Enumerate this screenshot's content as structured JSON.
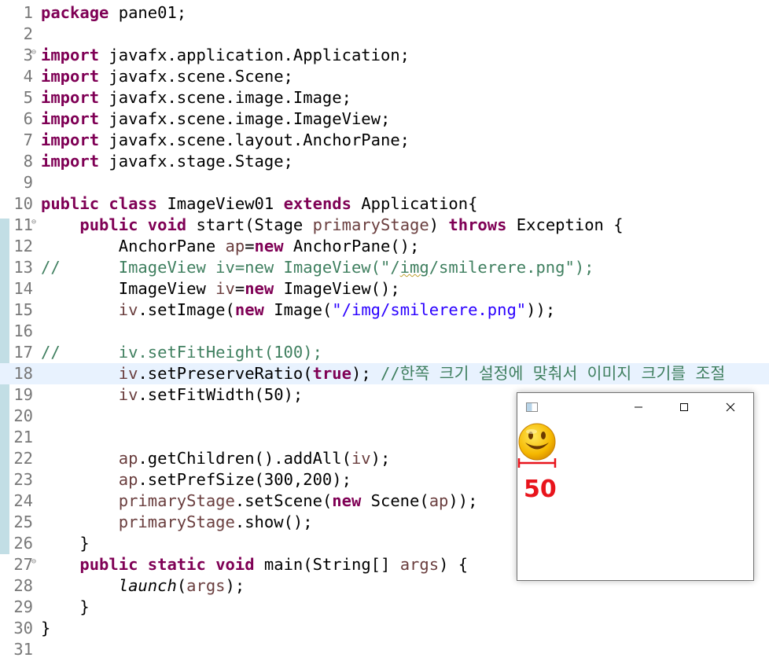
{
  "editor": {
    "lines": [
      {
        "num": "1",
        "fold": "",
        "current": false,
        "segments": [
          {
            "t": "package",
            "c": "kw"
          },
          {
            "t": " pane01;",
            "c": ""
          }
        ]
      },
      {
        "num": "2",
        "fold": "",
        "current": false,
        "segments": []
      },
      {
        "num": "3",
        "fold": "⊖",
        "current": false,
        "segments": [
          {
            "t": "import",
            "c": "kw"
          },
          {
            "t": " javafx.application.Application;",
            "c": ""
          }
        ]
      },
      {
        "num": "4",
        "fold": "",
        "current": false,
        "segments": [
          {
            "t": "import",
            "c": "kw"
          },
          {
            "t": " javafx.scene.Scene;",
            "c": ""
          }
        ]
      },
      {
        "num": "5",
        "fold": "",
        "current": false,
        "segments": [
          {
            "t": "import",
            "c": "kw"
          },
          {
            "t": " javafx.scene.image.Image;",
            "c": ""
          }
        ]
      },
      {
        "num": "6",
        "fold": "",
        "current": false,
        "segments": [
          {
            "t": "import",
            "c": "kw"
          },
          {
            "t": " javafx.scene.image.ImageView;",
            "c": ""
          }
        ]
      },
      {
        "num": "7",
        "fold": "",
        "current": false,
        "segments": [
          {
            "t": "import",
            "c": "kw"
          },
          {
            "t": " javafx.scene.layout.AnchorPane;",
            "c": ""
          }
        ]
      },
      {
        "num": "8",
        "fold": "",
        "current": false,
        "segments": [
          {
            "t": "import",
            "c": "kw"
          },
          {
            "t": " javafx.stage.Stage;",
            "c": ""
          }
        ]
      },
      {
        "num": "9",
        "fold": "",
        "current": false,
        "segments": []
      },
      {
        "num": "10",
        "fold": "",
        "current": false,
        "segments": [
          {
            "t": "public",
            "c": "kw"
          },
          {
            "t": " ",
            "c": ""
          },
          {
            "t": "class",
            "c": "kw"
          },
          {
            "t": " ImageView01 ",
            "c": ""
          },
          {
            "t": "extends",
            "c": "kw"
          },
          {
            "t": " Application{",
            "c": ""
          }
        ]
      },
      {
        "num": "11",
        "fold": "⊖",
        "current": false,
        "segments": [
          {
            "t": "    ",
            "c": ""
          },
          {
            "t": "public",
            "c": "kw"
          },
          {
            "t": " ",
            "c": ""
          },
          {
            "t": "void",
            "c": "kw"
          },
          {
            "t": " start(Stage ",
            "c": ""
          },
          {
            "t": "primaryStage",
            "c": "var"
          },
          {
            "t": ") ",
            "c": ""
          },
          {
            "t": "throws",
            "c": "kw"
          },
          {
            "t": " Exception {",
            "c": ""
          }
        ]
      },
      {
        "num": "12",
        "fold": "",
        "current": false,
        "segments": [
          {
            "t": "        AnchorPane ",
            "c": ""
          },
          {
            "t": "ap",
            "c": "var"
          },
          {
            "t": "=",
            "c": ""
          },
          {
            "t": "new",
            "c": "kw"
          },
          {
            "t": " AnchorPane();",
            "c": ""
          }
        ]
      },
      {
        "num": "13",
        "fold": "",
        "current": false,
        "segments": [
          {
            "t": "//      ImageView iv=new ImageView(\"/",
            "c": "cmt"
          },
          {
            "t": "img",
            "c": "cmt squiggle"
          },
          {
            "t": "/smilerere.png\");",
            "c": "cmt"
          }
        ]
      },
      {
        "num": "14",
        "fold": "",
        "current": false,
        "segments": [
          {
            "t": "        ImageView ",
            "c": ""
          },
          {
            "t": "iv",
            "c": "var"
          },
          {
            "t": "=",
            "c": ""
          },
          {
            "t": "new",
            "c": "kw"
          },
          {
            "t": " ImageView();",
            "c": ""
          }
        ]
      },
      {
        "num": "15",
        "fold": "",
        "current": false,
        "segments": [
          {
            "t": "        ",
            "c": ""
          },
          {
            "t": "iv",
            "c": "var"
          },
          {
            "t": ".setImage(",
            "c": ""
          },
          {
            "t": "new",
            "c": "kw"
          },
          {
            "t": " Image(",
            "c": ""
          },
          {
            "t": "\"/img/smilerere.png\"",
            "c": "str"
          },
          {
            "t": "));",
            "c": ""
          }
        ]
      },
      {
        "num": "16",
        "fold": "",
        "current": false,
        "segments": []
      },
      {
        "num": "17",
        "fold": "",
        "current": false,
        "segments": [
          {
            "t": "//      iv.setFitHeight(100);",
            "c": "cmt"
          }
        ]
      },
      {
        "num": "18",
        "fold": "",
        "current": true,
        "segments": [
          {
            "t": "        ",
            "c": ""
          },
          {
            "t": "iv",
            "c": "var"
          },
          {
            "t": ".setPreserveRatio(",
            "c": ""
          },
          {
            "t": "true",
            "c": "kw"
          },
          {
            "t": "); ",
            "c": ""
          },
          {
            "t": "//한쪽 크기 설정에 맞춰서 이미지 크기를 조절",
            "c": "cmt"
          }
        ]
      },
      {
        "num": "19",
        "fold": "",
        "current": false,
        "segments": [
          {
            "t": "        ",
            "c": ""
          },
          {
            "t": "iv",
            "c": "var"
          },
          {
            "t": ".setFitWidth(50);",
            "c": ""
          }
        ]
      },
      {
        "num": "20",
        "fold": "",
        "current": false,
        "segments": []
      },
      {
        "num": "21",
        "fold": "",
        "current": false,
        "segments": []
      },
      {
        "num": "22",
        "fold": "",
        "current": false,
        "segments": [
          {
            "t": "        ",
            "c": ""
          },
          {
            "t": "ap",
            "c": "var"
          },
          {
            "t": ".getChildren().addAll(",
            "c": ""
          },
          {
            "t": "iv",
            "c": "var"
          },
          {
            "t": ");",
            "c": ""
          }
        ]
      },
      {
        "num": "23",
        "fold": "",
        "current": false,
        "segments": [
          {
            "t": "        ",
            "c": ""
          },
          {
            "t": "ap",
            "c": "var"
          },
          {
            "t": ".setPrefSize(300,200);",
            "c": ""
          }
        ]
      },
      {
        "num": "24",
        "fold": "",
        "current": false,
        "segments": [
          {
            "t": "        ",
            "c": ""
          },
          {
            "t": "primaryStage",
            "c": "var"
          },
          {
            "t": ".setScene(",
            "c": ""
          },
          {
            "t": "new",
            "c": "kw"
          },
          {
            "t": " Scene(",
            "c": ""
          },
          {
            "t": "ap",
            "c": "var"
          },
          {
            "t": "));",
            "c": ""
          }
        ]
      },
      {
        "num": "25",
        "fold": "",
        "current": false,
        "segments": [
          {
            "t": "        ",
            "c": ""
          },
          {
            "t": "primaryStage",
            "c": "var"
          },
          {
            "t": ".show();",
            "c": ""
          }
        ]
      },
      {
        "num": "26",
        "fold": "",
        "current": false,
        "segments": [
          {
            "t": "    }",
            "c": ""
          }
        ]
      },
      {
        "num": "27",
        "fold": "⊖",
        "current": false,
        "segments": [
          {
            "t": "    ",
            "c": ""
          },
          {
            "t": "public",
            "c": "kw"
          },
          {
            "t": " ",
            "c": ""
          },
          {
            "t": "static",
            "c": "kw"
          },
          {
            "t": " ",
            "c": ""
          },
          {
            "t": "void",
            "c": "kw"
          },
          {
            "t": " main(String[] ",
            "c": ""
          },
          {
            "t": "args",
            "c": "var"
          },
          {
            "t": ") {",
            "c": ""
          }
        ]
      },
      {
        "num": "28",
        "fold": "",
        "current": false,
        "segments": [
          {
            "t": "        ",
            "c": ""
          },
          {
            "t": "launch",
            "c": "static"
          },
          {
            "t": "(",
            "c": ""
          },
          {
            "t": "args",
            "c": "var"
          },
          {
            "t": ");",
            "c": ""
          }
        ]
      },
      {
        "num": "29",
        "fold": "",
        "current": false,
        "segments": [
          {
            "t": "    }",
            "c": ""
          }
        ]
      },
      {
        "num": "30",
        "fold": "",
        "current": false,
        "segments": [
          {
            "t": "}",
            "c": ""
          }
        ]
      },
      {
        "num": "31",
        "fold": "",
        "current": false,
        "segments": []
      }
    ]
  },
  "fx_window": {
    "title": "",
    "annotation_text": "50",
    "colors": {
      "annotation": "#e8141c",
      "smiley_face": "#f5b800",
      "smiley_features": "#6b3a00"
    }
  },
  "colors": {
    "keyword": "#7f0055",
    "string": "#2a00ff",
    "comment": "#3f7f5f",
    "variable": "#6a3e3e",
    "line_number": "#787878",
    "current_line_bg": "#e8f2fe"
  }
}
